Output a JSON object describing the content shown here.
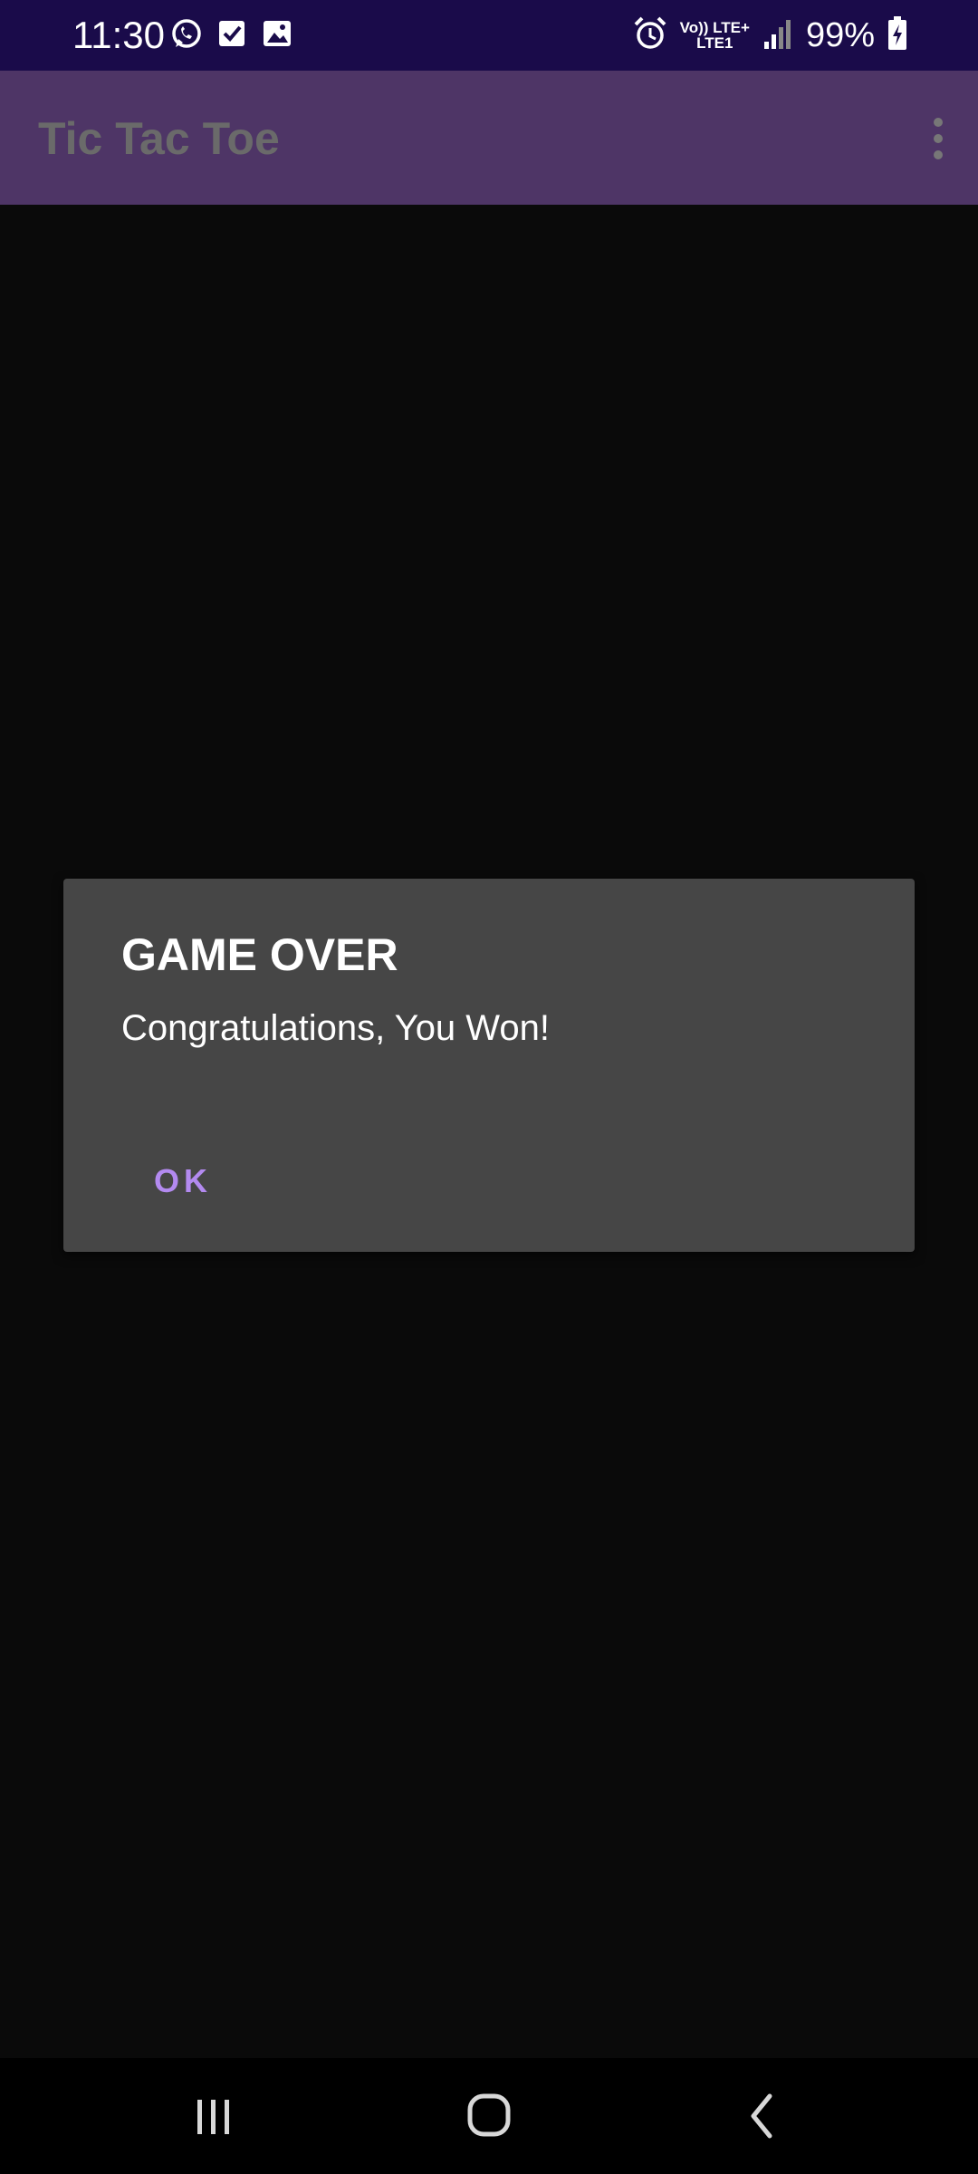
{
  "status_bar": {
    "time": "11:30",
    "left_icons": [
      "whatsapp-icon",
      "checkbox-icon",
      "gallery-icon"
    ],
    "right_icons": [
      "alarm-icon",
      "signal-icon",
      "battery-charging-icon"
    ],
    "network_top": "Vo)) LTE+",
    "network_bottom": "LTE1",
    "battery": "99%"
  },
  "app_bar": {
    "title": "Tic Tac Toe",
    "menu_icon": "overflow-menu-icon"
  },
  "dialog": {
    "title": "GAME OVER",
    "message": "Congratulations, You Won!",
    "ok_label": "OK"
  },
  "nav_bar": {
    "buttons": [
      "recents-icon",
      "home-icon",
      "back-icon"
    ]
  },
  "colors": {
    "status_bar_bg": "#1a0b4a",
    "app_bar_bg": "#4e3566",
    "dialog_bg": "#464646",
    "accent": "#b38af0",
    "screen_bg": "#0a0a0a"
  }
}
